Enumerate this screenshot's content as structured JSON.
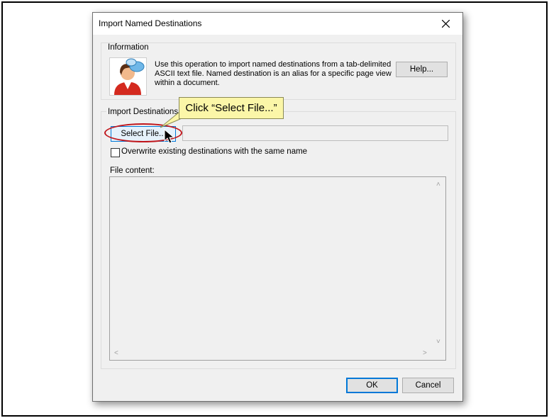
{
  "dialog": {
    "title": "Import Named Destinations",
    "close_icon": "close-icon"
  },
  "information": {
    "group_label": "Information",
    "avatar_icon": "user-speech-bubbles-icon",
    "text": "Use this operation to import named destinations from a tab-delimited ASCII text file. Named destination is an alias for a specific page view within a document.",
    "help_label": "Help..."
  },
  "import": {
    "group_label": "Import Destinations",
    "select_file_label": "Select File...",
    "file_path_value": "",
    "overwrite_label": "Overwrite existing destinations with the same name",
    "overwrite_checked": false,
    "content_label": "File content:"
  },
  "footer": {
    "ok_label": "OK",
    "cancel_label": "Cancel"
  },
  "annotation": {
    "callout_text": "Click “Select File...”",
    "highlight_color": "#c0161c",
    "callout_color": "#fbf6a8"
  }
}
